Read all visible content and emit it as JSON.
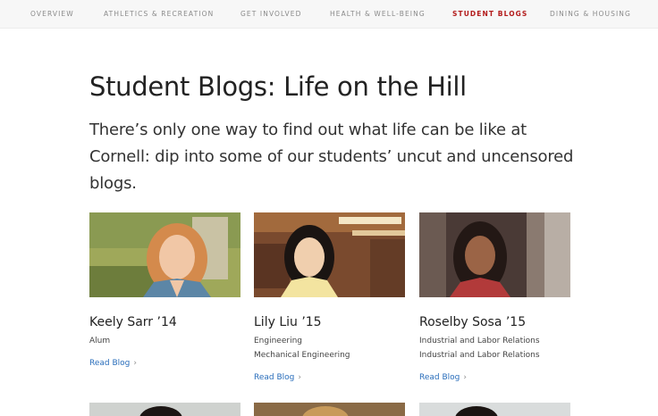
{
  "nav": {
    "items": [
      {
        "label": "OVERVIEW",
        "active": false
      },
      {
        "label": "ATHLETICS & RECREATION",
        "active": false
      },
      {
        "label": "GET INVOLVED",
        "active": false
      },
      {
        "label": "HEALTH & WELL-BEING",
        "active": false
      },
      {
        "label": "STUDENT BLOGS",
        "active": true
      },
      {
        "label": "DINING & HOUSING",
        "active": false
      }
    ]
  },
  "page": {
    "title": "Student Blogs: Life on the Hill",
    "intro": "There’s only one way to find out what life can be like at Cornell: dip into some of our students’ uncut and uncensored blogs."
  },
  "blogs": [
    {
      "name": "Keely Sarr ’14",
      "lines": [
        "Alum"
      ],
      "link": "Read Blog"
    },
    {
      "name": "Lily Liu ’15",
      "lines": [
        "Engineering",
        "Mechanical Engineering"
      ],
      "link": "Read Blog"
    },
    {
      "name": "Roselby Sosa ’15",
      "lines": [
        "Industrial and Labor Relations",
        "Industrial and Labor Relations"
      ],
      "link": "Read Blog"
    }
  ],
  "icons": {
    "chevron": "›"
  },
  "colors": {
    "accent": "#b31b1b",
    "link": "#2a6ebb",
    "nav_bg": "#f7f7f7"
  }
}
